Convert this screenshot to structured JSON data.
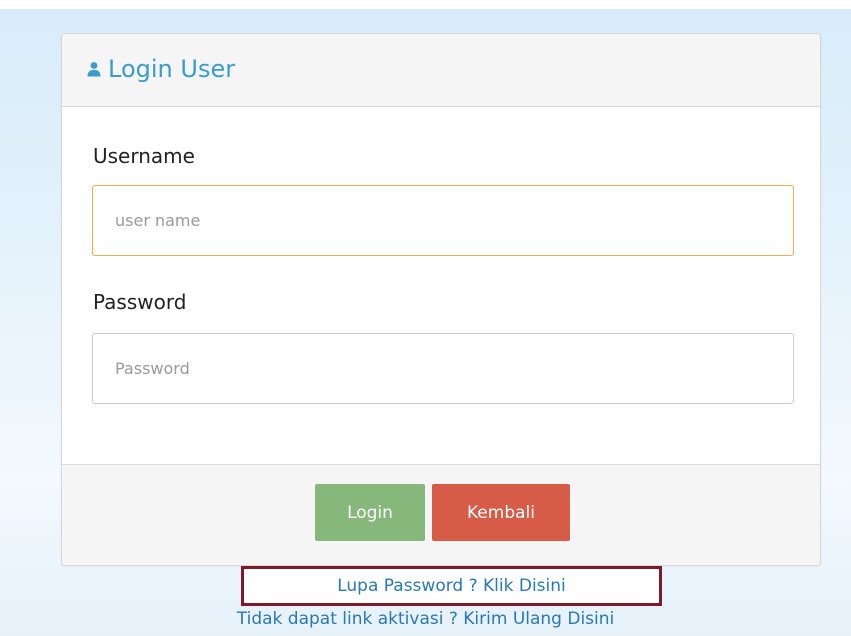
{
  "panel": {
    "title": "Login User",
    "title_icon": "user-icon"
  },
  "form": {
    "username_label": "Username",
    "username_placeholder": "user name",
    "username_value": "",
    "password_label": "Password",
    "password_placeholder": "Password",
    "password_value": ""
  },
  "buttons": {
    "login_label": "Login",
    "back_label": "Kembali"
  },
  "links": {
    "forgot_password": "Lupa Password ? Klik Disini",
    "resend_activation": "Tidak dapat link aktivasi ? Kirim Ulang Disini"
  },
  "colors": {
    "accent": "#3b9ccc",
    "login_button": "#86b87c",
    "back_button": "#d65c48",
    "focus_border": "#f0ad4e",
    "highlight_border": "#7c1c2a"
  }
}
